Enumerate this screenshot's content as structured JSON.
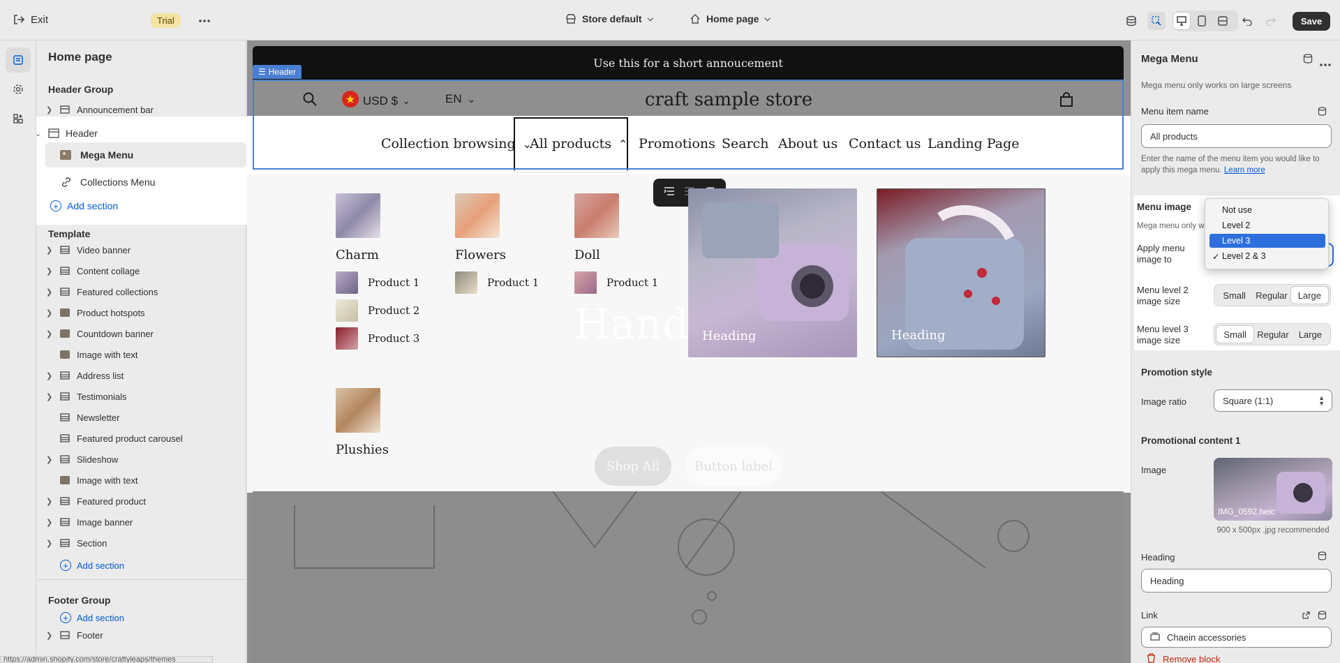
{
  "topbar": {
    "exit_label": "Exit",
    "trial_badge": "Trial",
    "theme_selector": "Store default",
    "page_selector": "Home page",
    "save_label": "Save"
  },
  "left_panel": {
    "title": "Home page",
    "header_group": "Header Group",
    "header_items": [
      {
        "label": "Announcement bar"
      },
      {
        "label": "Header"
      },
      {
        "label": "Mega Menu"
      },
      {
        "label": "Collections Menu"
      }
    ],
    "add_section": "Add section",
    "template_group": "Template",
    "template_items": [
      {
        "label": "Video banner"
      },
      {
        "label": "Content collage"
      },
      {
        "label": "Featured collections"
      },
      {
        "label": "Product hotspots"
      },
      {
        "label": "Countdown banner"
      },
      {
        "label": "Image with text"
      },
      {
        "label": "Address list"
      },
      {
        "label": "Testimonials"
      },
      {
        "label": "Newsletter"
      },
      {
        "label": "Featured product carousel"
      },
      {
        "label": "Slideshow"
      },
      {
        "label": "Image with text"
      },
      {
        "label": "Featured product"
      },
      {
        "label": "Image banner"
      },
      {
        "label": "Section"
      }
    ],
    "footer_group": "Footer Group",
    "footer_items": [
      {
        "label": "Footer"
      }
    ],
    "status_url": "https://admin.shopify.com/store/craftyleaps/themes"
  },
  "preview": {
    "announcement": "Use this for a short annoucement",
    "header_tag": "Header",
    "currency": "USD $",
    "language": "EN",
    "store_name": "craft sample store",
    "nav": [
      "Collection browsing",
      "All products",
      "Promotions",
      "Search",
      "About us",
      "Contact us",
      "Landing Page"
    ],
    "categories": [
      {
        "name": "Charm",
        "products": [
          "Product 1",
          "Product 2",
          "Product 3"
        ]
      },
      {
        "name": "Flowers",
        "products": [
          "Product 1"
        ]
      },
      {
        "name": "Doll",
        "products": [
          "Product 1"
        ]
      },
      {
        "name": "Plushies",
        "products": []
      }
    ],
    "promos": [
      {
        "heading": "Heading"
      },
      {
        "heading": "Heading"
      }
    ],
    "bg_heading": "Hand",
    "bg_buttons": [
      "Shop All",
      "Button label"
    ]
  },
  "right_panel": {
    "title": "Mega Menu",
    "note": "Mega menu only works on large screens",
    "menu_item_name_label": "Menu item name",
    "menu_item_name_value": "All products",
    "menu_item_help": "Enter the name of the menu item you would like to apply this mega menu.",
    "learn_more": "Learn more",
    "menu_image_title": "Menu image",
    "menu_image_help": "Mega menu only w",
    "apply_label": "Apply menu image to",
    "apply_options": [
      "Not use",
      "Level 2",
      "Level 3",
      "Level 2 & 3"
    ],
    "apply_highlighted": "Level 3",
    "apply_checked": "Level 2 & 3",
    "level2_label": "Menu level 2 image size",
    "level3_label": "Menu level 3 image size",
    "size_options": [
      "Small",
      "Regular",
      "Large"
    ],
    "level2_selected": "Large",
    "level3_selected": "Small",
    "promotion_style": "Promotion style",
    "image_ratio_label": "Image ratio",
    "image_ratio_value": "Square (1:1)",
    "promo_content": "Promotional content 1",
    "image_label": "Image",
    "image_filename": "IMG_0592.heic",
    "image_rec": "900 x 500px .jpg recommended",
    "heading_label": "Heading",
    "heading_value": "Heading",
    "link_label": "Link",
    "link_value": "Chaein accessories",
    "remove_block": "Remove block"
  }
}
